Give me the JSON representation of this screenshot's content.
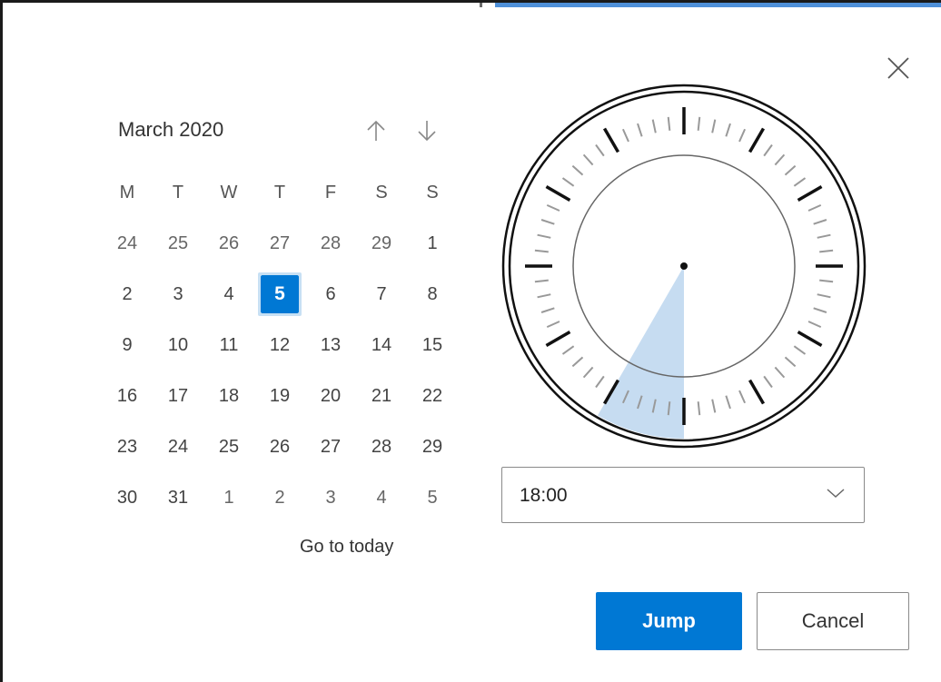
{
  "dialog": {
    "colors": {
      "accent": "#0078d4",
      "selection_ring": "#c7e0f4",
      "sector": "#c6dcf1"
    }
  },
  "icons": {
    "close": "close-icon",
    "prev_month": "arrow-up-icon",
    "next_month": "arrow-down-icon",
    "dropdown": "chevron-down-icon"
  },
  "calendar": {
    "month_label": "March 2020",
    "weekday_headers": [
      "M",
      "T",
      "W",
      "T",
      "F",
      "S",
      "S"
    ],
    "weeks": [
      [
        "24",
        "25",
        "26",
        "27",
        "28",
        "29",
        "1"
      ],
      [
        "2",
        "3",
        "4",
        "5",
        "6",
        "7",
        "8"
      ],
      [
        "9",
        "10",
        "11",
        "12",
        "13",
        "14",
        "15"
      ],
      [
        "16",
        "17",
        "18",
        "19",
        "20",
        "21",
        "22"
      ],
      [
        "23",
        "24",
        "25",
        "26",
        "27",
        "28",
        "29"
      ],
      [
        "30",
        "31",
        "1",
        "2",
        "3",
        "4",
        "5"
      ]
    ],
    "selected_day": "5",
    "go_to_today_label": "Go to today"
  },
  "clock": {
    "selected_time": "18:00",
    "selected_hour": 18,
    "selected_minute": 0
  },
  "time_dropdown": {
    "value": "18:00"
  },
  "buttons": {
    "jump_label": "Jump",
    "cancel_label": "Cancel"
  }
}
